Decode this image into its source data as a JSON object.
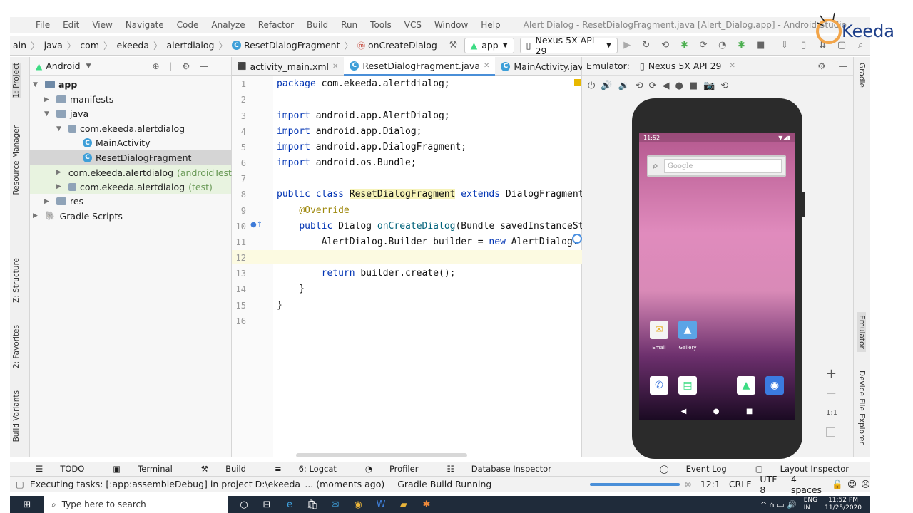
{
  "window_title": "Alert Dialog - ResetDialogFragment.java [Alert_Dialog.app] - Android Studio",
  "menu": [
    "File",
    "Edit",
    "View",
    "Navigate",
    "Code",
    "Analyze",
    "Refactor",
    "Build",
    "Run",
    "Tools",
    "VCS",
    "Window",
    "Help"
  ],
  "breadcrumb": [
    "ain",
    "java",
    "com",
    "ekeeda",
    "alertdialog",
    "ResetDialogFragment",
    "onCreateDialog"
  ],
  "run_config": "app",
  "device": "Nexus 5X API 29",
  "left_tabs": [
    "1: Project",
    "Resource Manager",
    "Z: Structure",
    "2: Favorites",
    "Build Variants"
  ],
  "project": {
    "view_mode": "Android",
    "tree": [
      {
        "label": "app",
        "level": 0,
        "kind": "module",
        "expanded": true,
        "bold": true
      },
      {
        "label": "manifests",
        "level": 1,
        "kind": "folder",
        "expanded": false
      },
      {
        "label": "java",
        "level": 1,
        "kind": "folder",
        "expanded": true
      },
      {
        "label": "com.ekeeda.alertdialog",
        "level": 2,
        "kind": "package",
        "expanded": true
      },
      {
        "label": "MainActivity",
        "level": 3,
        "kind": "class"
      },
      {
        "label": "ResetDialogFragment",
        "level": 3,
        "kind": "class",
        "selected": true
      },
      {
        "label": "com.ekeeda.alertdialog",
        "suffix": "(androidTest)",
        "level": 2,
        "kind": "package",
        "expanded": false,
        "test": true
      },
      {
        "label": "com.ekeeda.alertdialog",
        "suffix": "(test)",
        "level": 2,
        "kind": "package",
        "expanded": false,
        "test": true
      },
      {
        "label": "res",
        "level": 1,
        "kind": "folder",
        "expanded": false
      },
      {
        "label": "Gradle Scripts",
        "level": 0,
        "kind": "gradle",
        "expanded": false
      }
    ]
  },
  "editor": {
    "tabs": [
      {
        "label": "activity_main.xml",
        "active": false
      },
      {
        "label": "ResetDialogFragment.java",
        "active": true
      },
      {
        "label": "MainActivity.java",
        "active": false
      }
    ],
    "line_numbers": [
      "1",
      "2",
      "3",
      "4",
      "5",
      "6",
      "7",
      "8",
      "9",
      "10",
      "11",
      "12",
      "13",
      "14",
      "15",
      "16"
    ]
  },
  "emulator": {
    "label": "Emulator:",
    "tab": "Nexus 5X API 29",
    "status_time": "11:52",
    "search_placeholder": "Google",
    "apps": [
      "Email",
      "Gallery"
    ],
    "zoom": "1:1"
  },
  "right_tabs": [
    "Gradle",
    "Emulator",
    "Device File Explorer"
  ],
  "bottom_tabs": [
    "TODO",
    "Terminal",
    "Build",
    "6: Logcat",
    "Profiler",
    "Database Inspector",
    "Event Log",
    "Layout Inspector"
  ],
  "status": {
    "message": "Executing tasks: [:app:assembleDebug] in project D:\\ekeeda_... (moments ago)",
    "gradle": "Gradle Build Running",
    "position": "12:1",
    "line_sep": "CRLF",
    "encoding": "UTF-8",
    "indent": "4 spaces"
  },
  "taskbar": {
    "search_placeholder": "Type here to search",
    "lang": "ENG",
    "lang_sub": "IN",
    "time": "11:52 PM",
    "date": "11/25/2020"
  },
  "logo_text": "Keeda",
  "colors": {
    "accent": "#4a8fd8",
    "keyword": "#0033b3",
    "annotation": "#9e880d",
    "method": "#00627a",
    "highlight": "#f6f3b9"
  }
}
